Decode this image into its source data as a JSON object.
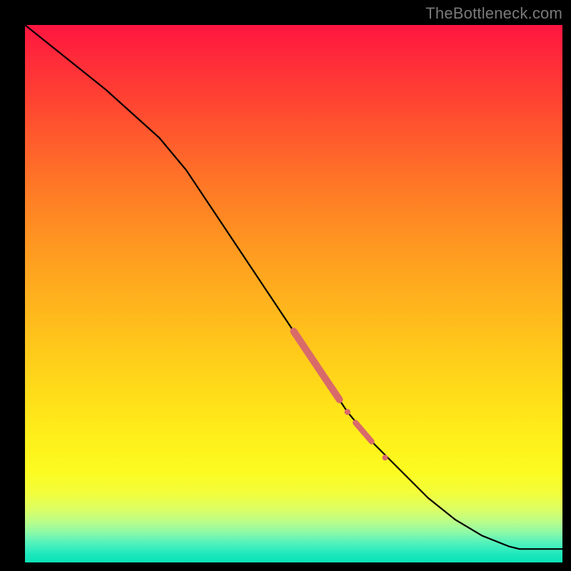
{
  "watermark": "TheBottleneck.com",
  "colors": {
    "overlay": "#d96a6a",
    "curve": "#000000",
    "frame_bg": "#000000"
  },
  "chart_data": {
    "type": "line",
    "title": "",
    "xlabel": "",
    "ylabel": "",
    "xlim": [
      0,
      100
    ],
    "ylim": [
      0,
      100
    ],
    "grid": false,
    "series": [
      {
        "name": "curve",
        "x": [
          0,
          5,
          10,
          15,
          20,
          25,
          30,
          35,
          40,
          45,
          50,
          55,
          60,
          65,
          70,
          75,
          80,
          85,
          90,
          92,
          95,
          100
        ],
        "y": [
          100,
          96,
          92,
          88,
          83.5,
          79,
          73,
          65.5,
          58,
          50.5,
          43,
          35.5,
          28,
          22,
          17,
          12,
          8,
          5,
          3,
          2.5,
          2.5,
          2.5
        ]
      }
    ],
    "overlay_segments": [
      {
        "x0": 50,
        "y0": 43,
        "x1": 58.5,
        "y1": 30.3,
        "width": 10
      },
      {
        "x0": 61.5,
        "y0": 26,
        "x1": 64.5,
        "y1": 22.5,
        "width": 8
      }
    ],
    "overlay_points": [
      {
        "x": 60,
        "y": 28,
        "r": 4.2
      },
      {
        "x": 67,
        "y": 19.5,
        "r": 4.0
      }
    ]
  }
}
